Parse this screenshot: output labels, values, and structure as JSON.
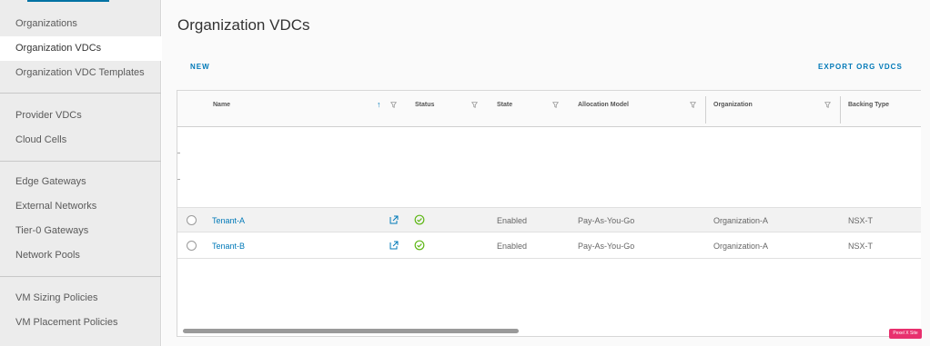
{
  "sidebar": {
    "group1": [
      {
        "label": "Organizations"
      },
      {
        "label": "Organization VDCs",
        "active": true
      },
      {
        "label": "Organization VDC Templates"
      }
    ],
    "group2": [
      {
        "label": "Provider VDCs"
      },
      {
        "label": "Cloud Cells"
      }
    ],
    "group3": [
      {
        "label": "Edge Gateways"
      },
      {
        "label": "External Networks"
      },
      {
        "label": "Tier-0 Gateways"
      },
      {
        "label": "Network Pools"
      }
    ],
    "group4": [
      {
        "label": "VM Sizing Policies"
      },
      {
        "label": "VM Placement Policies"
      }
    ]
  },
  "main": {
    "title": "Organization VDCs",
    "new_label": "NEW",
    "export_label": "EXPORT ORG VDCS"
  },
  "grid": {
    "columns": [
      "Name",
      "Status",
      "State",
      "Allocation Model",
      "Organization",
      "Backing Type"
    ],
    "sort_indicator": "↑",
    "rows": [
      {
        "name": "Tenant-A",
        "state": "Enabled",
        "allocation": "Pay-As-You-Go",
        "organization": "Organization-A",
        "backing": "NSX-T"
      },
      {
        "name": "Tenant-B",
        "state": "Enabled",
        "allocation": "Pay-As-You-Go",
        "organization": "Organization-A",
        "backing": "NSX-T"
      }
    ]
  },
  "badge": {
    "label": "Pexel X Site"
  },
  "colors": {
    "accent": "#0079b8",
    "status_ok": "#5eb715",
    "sidebar_bg": "#ececec"
  },
  "icons": {
    "filter": "filter-icon",
    "external_link": "external-link-icon",
    "status": "check-circle-icon",
    "radio": "radio-button"
  }
}
